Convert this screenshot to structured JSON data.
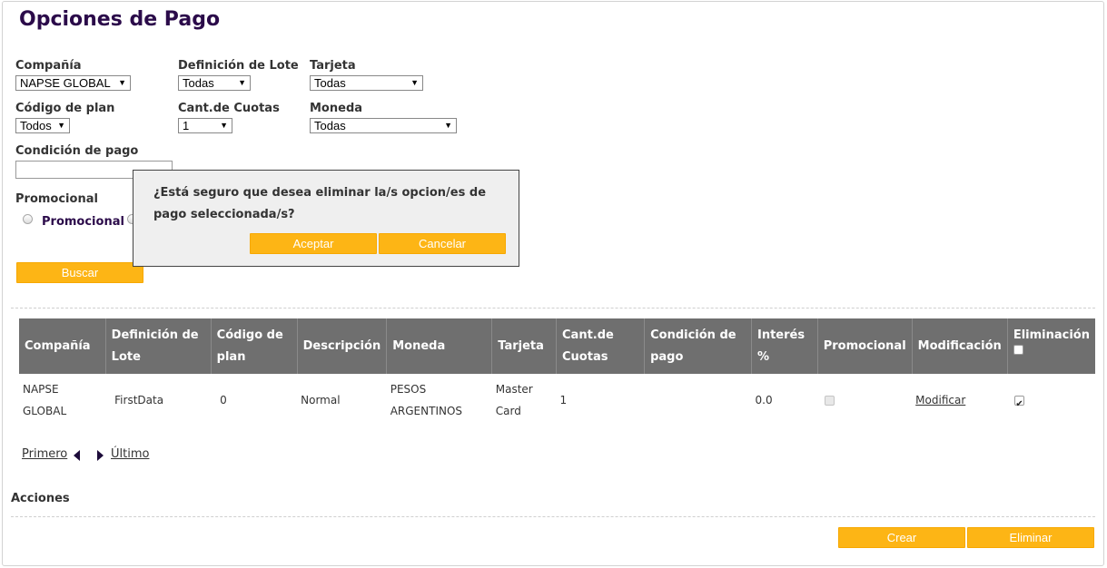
{
  "page": {
    "title": "Opciones de Pago"
  },
  "filters": {
    "compania": {
      "label": "Compañía",
      "value": "NAPSE GLOBAL"
    },
    "definicion_lote": {
      "label": "Definición de Lote",
      "value": "Todas"
    },
    "tarjeta": {
      "label": "Tarjeta",
      "value": "Todas"
    },
    "codigo_plan": {
      "label": "Código de plan",
      "value": "Todos"
    },
    "cant_cuotas": {
      "label": "Cant.de Cuotas",
      "value": "1"
    },
    "moneda": {
      "label": "Moneda",
      "value": "Todas"
    },
    "condicion_pago": {
      "label": "Condición de pago",
      "value": ""
    },
    "promocional": {
      "label": "Promocional",
      "option_label": "Promocional"
    },
    "search_button": "Buscar"
  },
  "dialog": {
    "message": "¿Está seguro que desea eliminar la/s opcion/es de pago seleccionada/s?",
    "accept_label": "Aceptar",
    "cancel_label": "Cancelar"
  },
  "table": {
    "headers": [
      "Compañía",
      "Definición de Lote",
      "Código de plan",
      "Descripción",
      "Moneda",
      "Tarjeta",
      "Cant.de Cuotas",
      "Condición de pago",
      "Interés %",
      "Promocional",
      "Modificación",
      "Eliminación"
    ],
    "rows": [
      {
        "compania": "NAPSE GLOBAL",
        "definicion_lote": "FirstData",
        "codigo_plan": "0",
        "descripcion": "Normal",
        "moneda": "PESOS ARGENTINOS",
        "tarjeta": "Master Card",
        "cant_cuotas": "1",
        "condicion_pago": "",
        "interes": "0.0",
        "promocional": false,
        "modificar_label": "Modificar",
        "eliminacion": true
      }
    ]
  },
  "pagination": {
    "first": "Primero",
    "last": "Último"
  },
  "actions": {
    "label": "Acciones",
    "create_label": "Crear",
    "delete_label": "Eliminar"
  },
  "colors": {
    "accent": "#fdb515",
    "title": "#2b0b4a",
    "table_header": "#6f6f6f"
  }
}
